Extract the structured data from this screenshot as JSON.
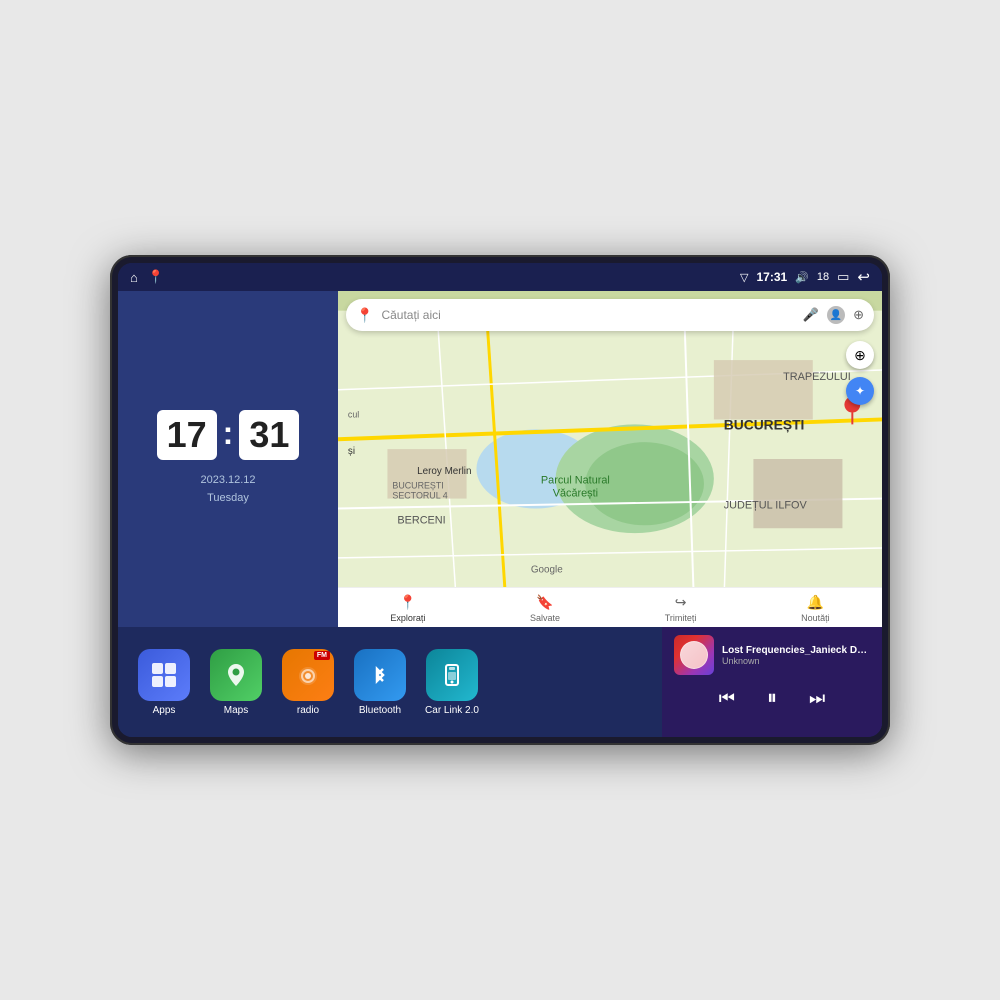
{
  "device": {
    "screen": {
      "statusBar": {
        "leftIcons": [
          "home-icon",
          "location-pin-icon"
        ],
        "signal": "▽",
        "time": "17:31",
        "volume_icon": "🔊",
        "battery_level": "18",
        "battery_icon": "▭",
        "back_icon": "↩"
      },
      "clockWidget": {
        "hours": "17",
        "minutes": "31",
        "date": "2023.12.12",
        "day": "Tuesday"
      },
      "mapWidget": {
        "searchPlaceholder": "Căutați aici",
        "navItems": [
          {
            "label": "Explorați",
            "active": true
          },
          {
            "label": "Salvate",
            "active": false
          },
          {
            "label": "Trimiteți",
            "active": false
          },
          {
            "label": "Noutăți",
            "active": false
          }
        ],
        "locationName": "BUCUREȘTI",
        "districtName": "JUDEȚUL ILFOV",
        "areaBerceni": "BERCENI",
        "areaTrapezului": "TRAPEZULUI",
        "parkLabel": "Parcul Natural Văcărești",
        "storeLabel": "Leroy Merlin",
        "sectorLabel": "BUCUREȘTI SECTORUL 4",
        "googleLabel": "Google"
      },
      "appIcons": [
        {
          "id": "apps",
          "label": "Apps",
          "icon": "⊞"
        },
        {
          "id": "maps",
          "label": "Maps",
          "icon": "📍"
        },
        {
          "id": "radio",
          "label": "radio",
          "icon": "📻",
          "badge": "FM"
        },
        {
          "id": "bluetooth",
          "label": "Bluetooth",
          "icon": "⬡"
        },
        {
          "id": "carlink",
          "label": "Car Link 2.0",
          "icon": "📱"
        }
      ],
      "musicPlayer": {
        "title": "Lost Frequencies_Janieck Devy-...",
        "artist": "Unknown",
        "controls": {
          "prev": "⏮",
          "play": "⏸",
          "next": "⏭"
        }
      }
    }
  }
}
